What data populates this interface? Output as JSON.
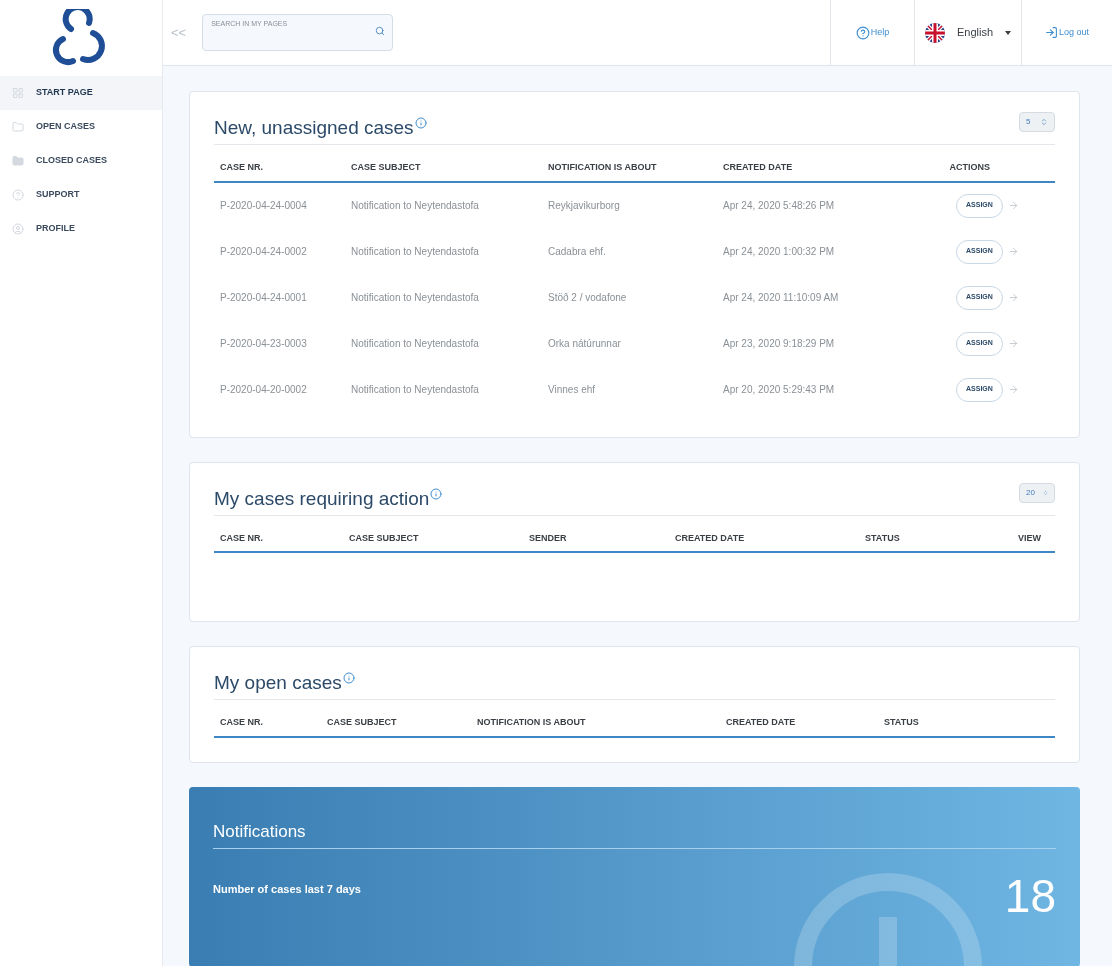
{
  "sidebar": {
    "items": [
      {
        "label": "START PAGE",
        "selected": true
      },
      {
        "label": "OPEN CASES",
        "selected": false
      },
      {
        "label": "CLOSED CASES",
        "selected": false
      },
      {
        "label": "SUPPORT",
        "selected": false
      },
      {
        "label": "PROFILE",
        "selected": false
      }
    ]
  },
  "header": {
    "collapse": "<<",
    "search": {
      "placeholder": "SEARCH IN MY PAGES"
    },
    "help": "Help",
    "language": "English",
    "logout": "Log out"
  },
  "sections": [
    {
      "title": "New, unassigned cases",
      "page_size": "5",
      "columns": [
        "CASE NR.",
        "CASE SUBJECT",
        "NOTIFICATION IS ABOUT",
        "CREATED DATE",
        "ACTIONS"
      ],
      "rows": [
        {
          "cells": [
            "P-2020-04-24-0004",
            "Notification to Neytendastofa",
            "Reykjavikurborg",
            "Apr 24, 2020 5:48:26 PM"
          ],
          "action": "ASSIGN"
        },
        {
          "cells": [
            "P-2020-04-24-0002",
            "Notification to Neytendastofa",
            "Cadabra ehf.",
            "Apr 24, 2020 1:00:32 PM"
          ],
          "action": "ASSIGN"
        },
        {
          "cells": [
            "P-2020-04-24-0001",
            "Notification to Neytendastofa",
            "Stöð 2 / vodafone",
            "Apr 24, 2020 11:10:09 AM"
          ],
          "action": "ASSIGN"
        },
        {
          "cells": [
            "P-2020-04-23-0003",
            "Notification to Neytendastofa",
            "Orka nátúrunnar",
            "Apr 23, 2020 9:18:29 PM"
          ],
          "action": "ASSIGN"
        },
        {
          "cells": [
            "P-2020-04-20-0002",
            "Notification to Neytendastofa",
            "Vinnes ehf",
            "Apr 20, 2020 5:29:43 PM"
          ],
          "action": "ASSIGN"
        }
      ]
    },
    {
      "title": "My cases requiring action",
      "page_size": "20",
      "columns": [
        "CASE NR.",
        "CASE SUBJECT",
        "SENDER",
        "CREATED DATE",
        "STATUS",
        "VIEW"
      ]
    },
    {
      "title": "My open cases",
      "columns": [
        "CASE NR.",
        "CASE SUBJECT",
        "NOTIFICATION IS ABOUT",
        "CREATED DATE",
        "STATUS"
      ]
    }
  ],
  "notifications": {
    "title": "Notifications",
    "label": "Number of cases last 7 days",
    "count": "18"
  }
}
